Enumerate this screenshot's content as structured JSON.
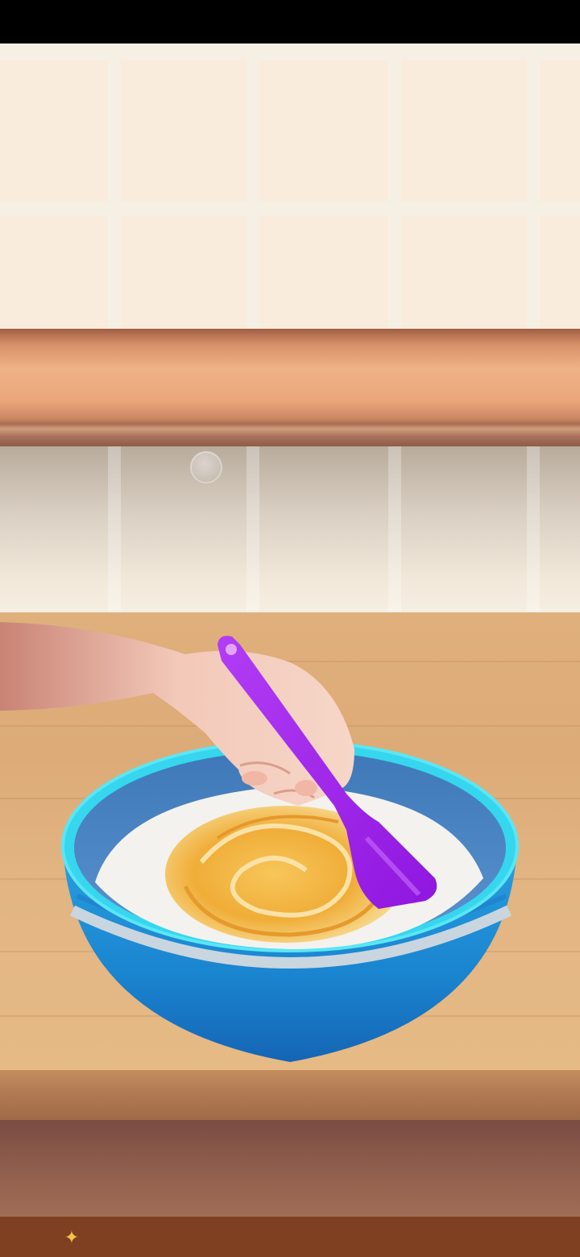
{
  "scene": {
    "name": "mixing-bowl-scene",
    "bowl_color": "#1a8fd6",
    "bowl_rim_color": "#36d6ef",
    "spatula_color": "#a221ee",
    "batter_color": "#f2b23c",
    "flour_color": "#f4f2ee"
  },
  "icons": {
    "bottom_sparkle": "sparkle-icon"
  }
}
